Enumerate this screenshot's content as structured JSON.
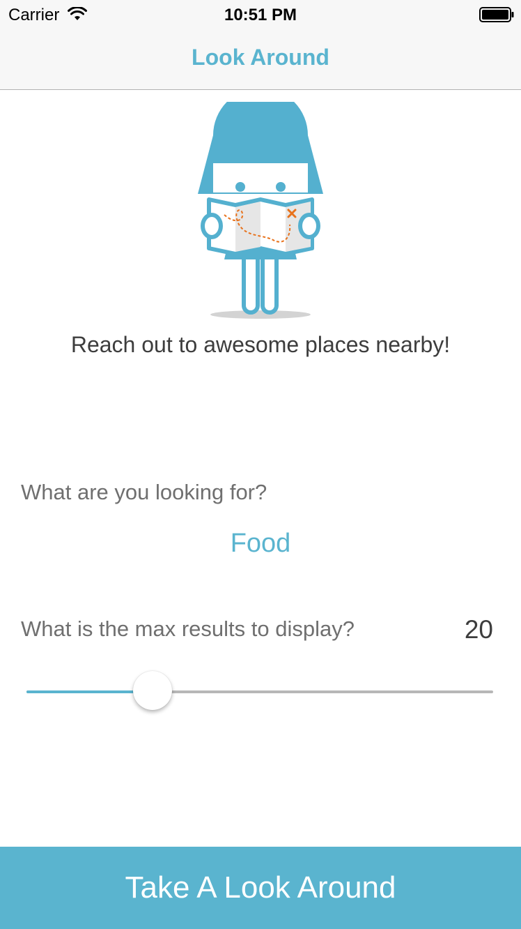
{
  "status_bar": {
    "carrier": "Carrier",
    "time": "10:51 PM",
    "icons": [
      "wifi-icon",
      "battery-icon"
    ]
  },
  "nav": {
    "title": "Look Around"
  },
  "hero": {
    "illustration": "explorer-mascot-with-map",
    "tagline": "Reach out to awesome places nearby!"
  },
  "search": {
    "question": "What are you looking for?",
    "selected": "Food"
  },
  "max_results": {
    "question": "What is the max results to display?",
    "value": "20",
    "slider_fraction": 0.27
  },
  "action": {
    "label": "Take A Look Around"
  },
  "colors": {
    "accent": "#5ab4cf",
    "map_marker": "#e8721c",
    "text_dark": "#3d3d3d",
    "text_light": "#6f6f6f"
  }
}
